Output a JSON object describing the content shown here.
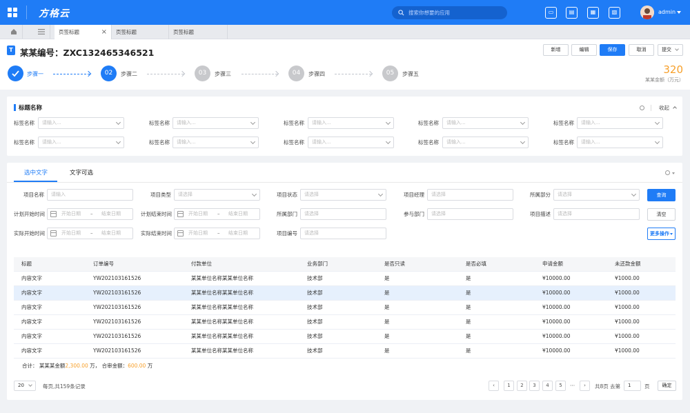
{
  "app": {
    "logo": "方格云",
    "search_placeholder": "搜索你想要的应用",
    "username": "admin"
  },
  "colors": {
    "primary": "#1f7cf6",
    "accent": "#f7a02b"
  },
  "page_tabs": [
    {
      "label": "页签标题",
      "active": true
    },
    {
      "label": "页签标题",
      "active": false
    },
    {
      "label": "页签标题",
      "active": false
    }
  ],
  "header": {
    "title_icon": "T",
    "title": "某某编号：ZXC132465346521",
    "buttons": {
      "add": "新增",
      "edit": "编辑",
      "save": "保存",
      "cancel": "取消",
      "submit": "提交"
    },
    "amount": "320",
    "amount_label": "某某金额（万元）"
  },
  "steps": [
    {
      "num": "",
      "label": "步骤一",
      "state": "done"
    },
    {
      "num": "02",
      "label": "步骤二",
      "state": "current"
    },
    {
      "num": "03",
      "label": "步骤三",
      "state": "todo"
    },
    {
      "num": "04",
      "label": "步骤四",
      "state": "todo"
    },
    {
      "num": "05",
      "label": "步骤五",
      "state": "todo"
    }
  ],
  "section1": {
    "title": "标题名称",
    "collapse": "收起",
    "field_label": "标签名称",
    "field_placeholder": "请输入..."
  },
  "section2": {
    "tabs": [
      "选中文字",
      "文字可选"
    ],
    "filters": {
      "project_name": "项目名称",
      "project_type": "项目类型",
      "project_status": "项目状态",
      "project_manager": "项目经理",
      "department": "所属部分",
      "plan_start": "计划开始时间",
      "plan_end": "计划结束时间",
      "dept": "所属部门",
      "participant": "参与部门",
      "project_desc": "项目描述",
      "actual_start": "实际开始时间",
      "actual_end": "实际结束时间",
      "project_no": "项目编号",
      "input_ph": "请输入",
      "select_ph": "请选择",
      "start_date": "开始日期",
      "end_date": "结束日期",
      "dash": "–"
    },
    "buttons": {
      "query": "查询",
      "clear": "清空",
      "more": "更多操作"
    }
  },
  "table": {
    "headers": [
      "标题",
      "订单编号",
      "付款单位",
      "业务部门",
      "是否只读",
      "是否必填",
      "申请金额",
      "未还款金额"
    ],
    "rows": [
      [
        "内容文字",
        "YW202103161526",
        "某某单位名称某某单位名称",
        "技术部",
        "是",
        "是",
        "¥10000.00",
        "¥1000.00"
      ],
      [
        "内容文字",
        "YW202103161526",
        "某某单位名称某某单位名称",
        "技术部",
        "是",
        "是",
        "¥10000.00",
        "¥1000.00"
      ],
      [
        "内容文字",
        "YW202103161526",
        "某某单位名称某某单位名称",
        "技术部",
        "是",
        "是",
        "¥10000.00",
        "¥1000.00"
      ],
      [
        "内容文字",
        "YW202103161526",
        "某某单位名称某某单位名称",
        "技术部",
        "是",
        "是",
        "¥10000.00",
        "¥1000.00"
      ],
      [
        "内容文字",
        "YW202103161526",
        "某某单位名称某某单位名称",
        "技术部",
        "是",
        "是",
        "¥10000.00",
        "¥1000.00"
      ],
      [
        "内容文字",
        "YW202103161526",
        "某某单位名称某某单位名称",
        "技术部",
        "是",
        "是",
        "¥10000.00",
        "¥1000.00"
      ]
    ],
    "highlight_row": 1,
    "summary": {
      "prefix": "合计：  某某某金额",
      "v1": "2,300.00",
      "u1": " 万，  合审金额：",
      "v2": "600.00",
      "u2": " 万"
    }
  },
  "pagination": {
    "page_size": "20",
    "per_page_text": "每页,共159条记录",
    "pages": [
      "1",
      "2",
      "3",
      "4",
      "5"
    ],
    "ellipsis": "···",
    "total_pages_text": "共8页 去第",
    "goto_value": "1",
    "page_unit": "页",
    "confirm": "确定"
  }
}
